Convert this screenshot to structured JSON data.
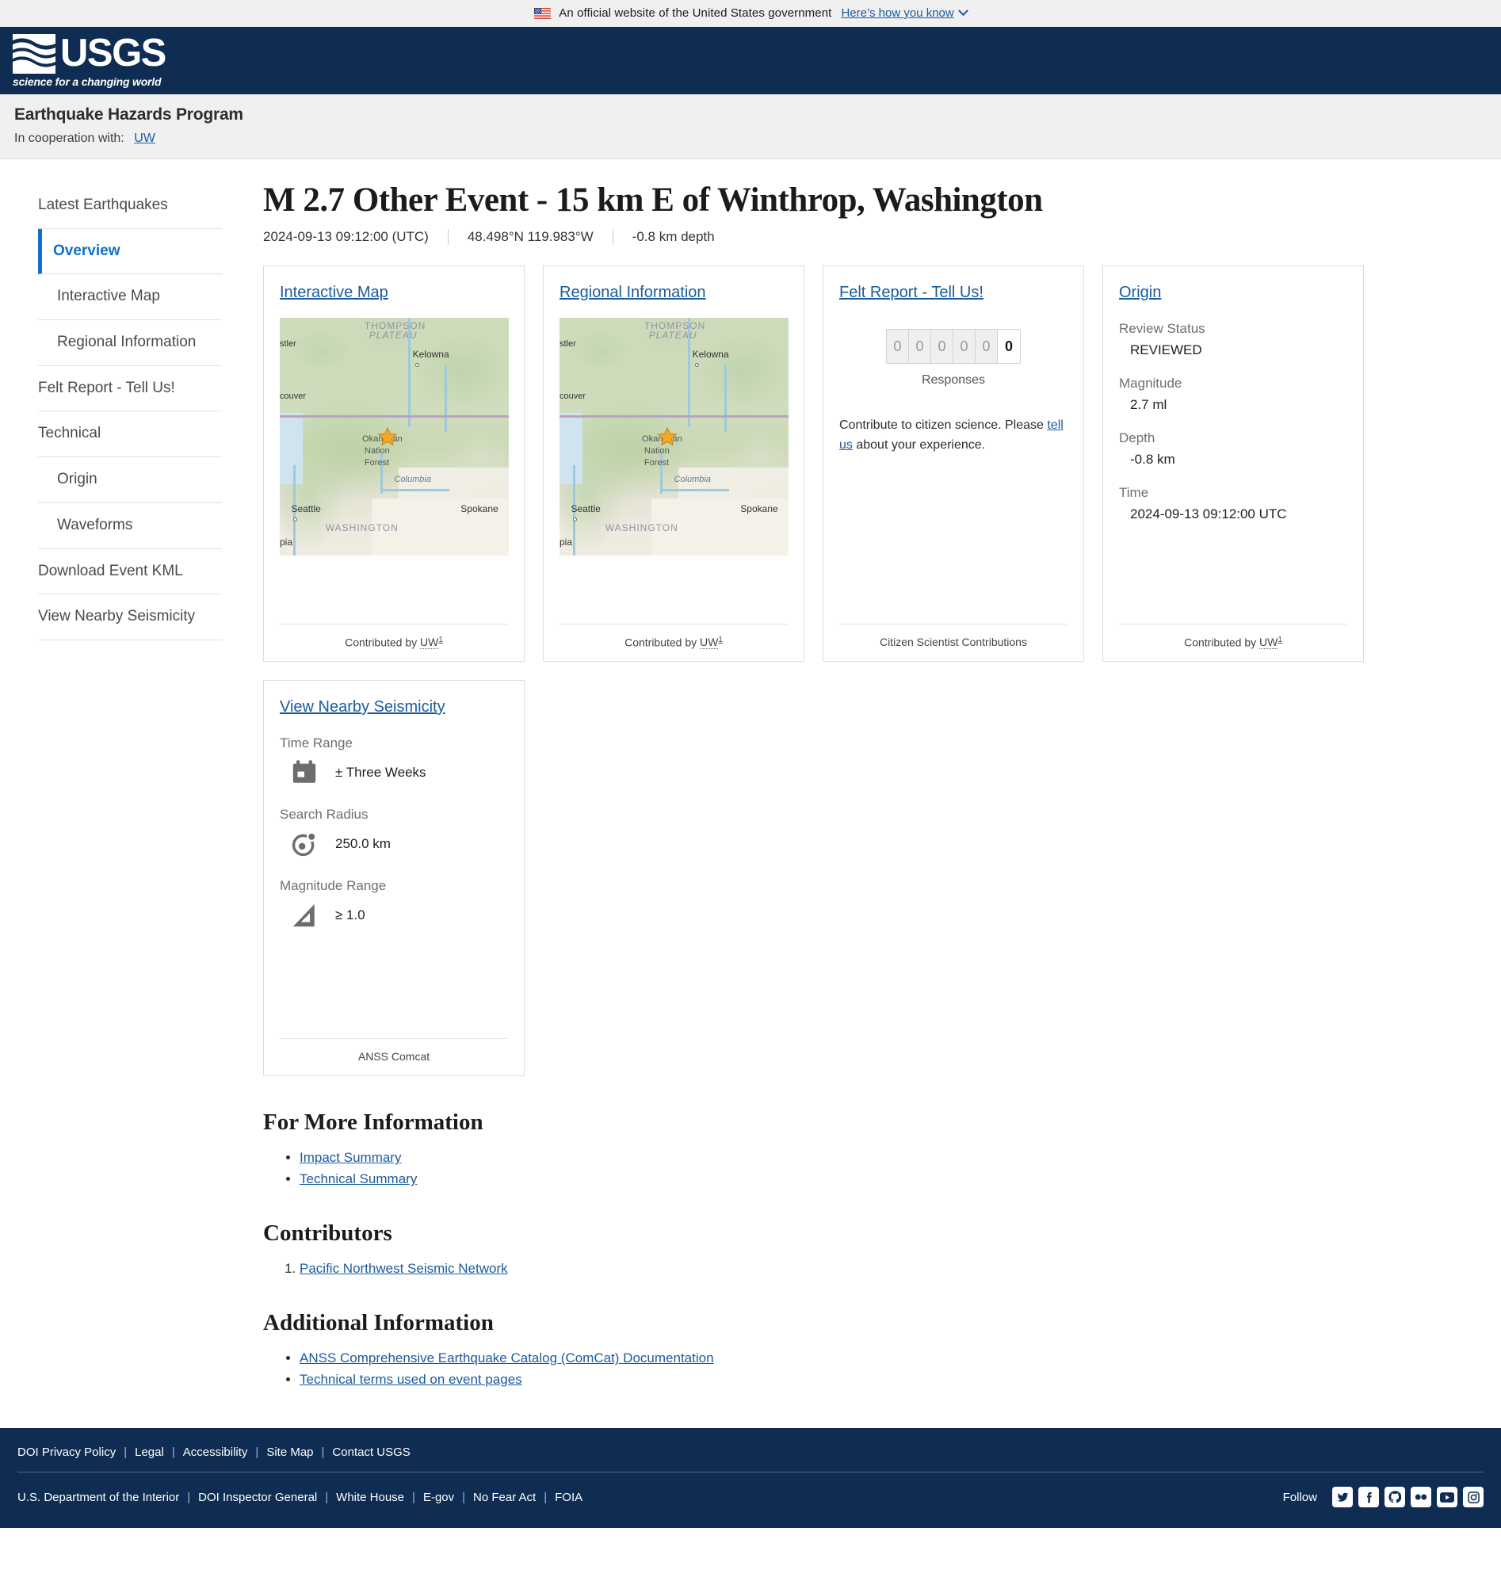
{
  "gov_banner": {
    "flag_icon": "us-flag-icon",
    "text": "An official website of the United States government",
    "link": "Here’s how you know",
    "chevron_icon": "chevron-down-icon"
  },
  "usgs_header": {
    "logo_icon": "usgs-wave-logo-icon",
    "wordmark": "USGS",
    "tagline": "science for a changing world"
  },
  "program": {
    "title": "Earthquake Hazards Program",
    "coop_label": "In cooperation with:",
    "coop_link": "UW"
  },
  "sidebar": {
    "items": [
      {
        "label": "Latest Earthquakes",
        "sub": false,
        "active": false
      },
      {
        "label": "Overview",
        "sub": false,
        "active": true
      },
      {
        "label": "Interactive Map",
        "sub": true,
        "active": false
      },
      {
        "label": "Regional Information",
        "sub": true,
        "active": false
      },
      {
        "label": "Felt Report - Tell Us!",
        "sub": false,
        "active": false
      },
      {
        "label": "Technical",
        "sub": false,
        "active": false
      },
      {
        "label": "Origin",
        "sub": true,
        "active": false
      },
      {
        "label": "Waveforms",
        "sub": true,
        "active": false
      },
      {
        "label": "Download Event KML",
        "sub": false,
        "active": false
      },
      {
        "label": "View Nearby Seismicity",
        "sub": false,
        "active": false
      }
    ]
  },
  "event": {
    "title": "M 2.7 Other Event - 15 km E of Winthrop, Washington",
    "time": "2024-09-13 09:12:00 (UTC)",
    "coords": "48.498°N 119.983°W",
    "depth": "-0.8 km depth"
  },
  "cards": {
    "interactive_map": {
      "title": "Interactive Map",
      "footer_prefix": "Contributed by ",
      "footer_abbr": "UW",
      "footer_sup": "1",
      "map_icon": "terrain-map-thumbnail",
      "star_icon": "epicenter-star-icon",
      "map_labels": {
        "plateau": "PLATEAU",
        "thompson": "THOMPSON",
        "kelowna": "Kelowna",
        "whistler": "stler",
        "vancouver": "couver",
        "okanogan": "Okanogan",
        "national": "Nation",
        "forest": "Forest",
        "columbia": "Columbia",
        "seattle": "Seattle",
        "olympia": "pia",
        "spokane": "Spokane",
        "washington": "WASHINGTON"
      }
    },
    "regional_information": {
      "title": "Regional Information",
      "footer_prefix": "Contributed by ",
      "footer_abbr": "UW",
      "footer_sup": "1"
    },
    "felt_report": {
      "title": "Felt Report - Tell Us!",
      "odometer": [
        "0",
        "0",
        "0",
        "0",
        "0",
        "0"
      ],
      "responses_label": "Responses",
      "text_before": "Contribute to citizen science. Please ",
      "text_link": "tell us",
      "text_after": " about your experience.",
      "footer": "Citizen Scientist Contributions"
    },
    "origin": {
      "title": "Origin",
      "fields": [
        {
          "label": "Review Status",
          "value": "REVIEWED"
        },
        {
          "label": "Magnitude",
          "value": "2.7 ml"
        },
        {
          "label": "Depth",
          "value": "-0.8 km"
        },
        {
          "label": "Time",
          "value": "2024-09-13 09:12:00 UTC"
        }
      ],
      "footer_prefix": "Contributed by ",
      "footer_abbr": "UW",
      "footer_sup": "1"
    },
    "nearby_seismicity": {
      "title": "View Nearby Seismicity",
      "rows": [
        {
          "label": "Time Range",
          "icon": "calendar-icon",
          "value": "± Three Weeks"
        },
        {
          "label": "Search Radius",
          "icon": "radius-target-icon",
          "value": "250.0 km"
        },
        {
          "label": "Magnitude Range",
          "icon": "magnitude-triangle-icon",
          "value": "≥ 1.0"
        }
      ],
      "footer": "ANSS Comcat"
    }
  },
  "sections": {
    "more_info": {
      "heading": "For More Information",
      "links": [
        "Impact Summary",
        "Technical Summary"
      ]
    },
    "contributors": {
      "heading": "Contributors",
      "links": [
        "Pacific Northwest Seismic Network"
      ]
    },
    "additional": {
      "heading": "Additional Information",
      "links": [
        "ANSS Comprehensive Earthquake Catalog (ComCat) Documentation",
        "Technical terms used on event pages"
      ]
    }
  },
  "footer": {
    "row1": [
      "DOI Privacy Policy",
      "Legal",
      "Accessibility",
      "Site Map",
      "Contact USGS"
    ],
    "row2": [
      "U.S. Department of the Interior",
      "DOI Inspector General",
      "White House",
      "E-gov",
      "No Fear Act",
      "FOIA"
    ],
    "follow_label": "Follow",
    "social": [
      "twitter-icon",
      "facebook-icon",
      "github-icon",
      "flickr-icon",
      "youtube-icon",
      "instagram-icon"
    ]
  },
  "colors": {
    "usgs_navy": "#0f2d52",
    "link_blue": "#1a5b9e",
    "active_blue": "#1070ca",
    "banner_gray": "#f0f0f0",
    "star_orange": "#f5a623"
  }
}
